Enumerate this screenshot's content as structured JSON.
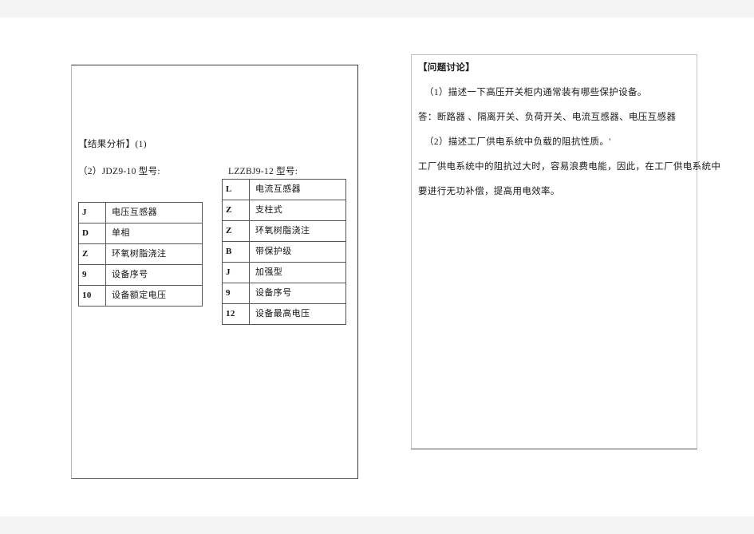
{
  "document": {
    "left_panel": {
      "name": "results-analysis-page",
      "heading": "【结果分析】(1)",
      "model_line": {
        "left": "（2）JDZ9-10 型号:",
        "right": "LZZBJ9-12 型号:"
      },
      "table_jdz": {
        "caption": "JDZ9-10",
        "rows": [
          {
            "code": "J",
            "meaning": "电压互感器"
          },
          {
            "code": "D",
            "meaning": "单相"
          },
          {
            "code": "Z",
            "meaning": "环氧树脂浇注"
          },
          {
            "code": "9",
            "meaning": "设备序号"
          },
          {
            "code": "10",
            "meaning": "设备额定电压"
          }
        ]
      },
      "table_lzzbj": {
        "caption": "LZZBJ9-12",
        "rows": [
          {
            "code": "L",
            "meaning": "电流互感器"
          },
          {
            "code": "Z",
            "meaning": "支柱式"
          },
          {
            "code": "Z",
            "meaning": "环氧树脂浇注"
          },
          {
            "code": "B",
            "meaning": "带保护级"
          },
          {
            "code": "J",
            "meaning": "加强型"
          },
          {
            "code": "9",
            "meaning": "设备序号"
          },
          {
            "code": "12",
            "meaning": "设备最高电压"
          }
        ]
      }
    },
    "right_panel": {
      "name": "question-discussion-page",
      "heading": "【问题讨论】",
      "lines": [
        "（1）描述一下高压开关柜内通常装有哪些保护设备。",
        "答：断路器 、隔离开关、负荷开关、电流互感器、电压互感器",
        "（2）描述工厂供电系统中负载的阻抗性质。'",
        "工厂供电系统中的阻抗过大时，容易浪费电能，因此，在工厂供电系统中",
        "要进行无功补偿，提高用电效率。"
      ]
    }
  },
  "colors": {
    "page_background": "#ffffff",
    "canvas_background": "#f4f4f4",
    "left_border_dark": "#3a3a3c",
    "right_border_light": "#c2c2c6",
    "table_border": "#54545a",
    "text": "#1a1a1a"
  }
}
